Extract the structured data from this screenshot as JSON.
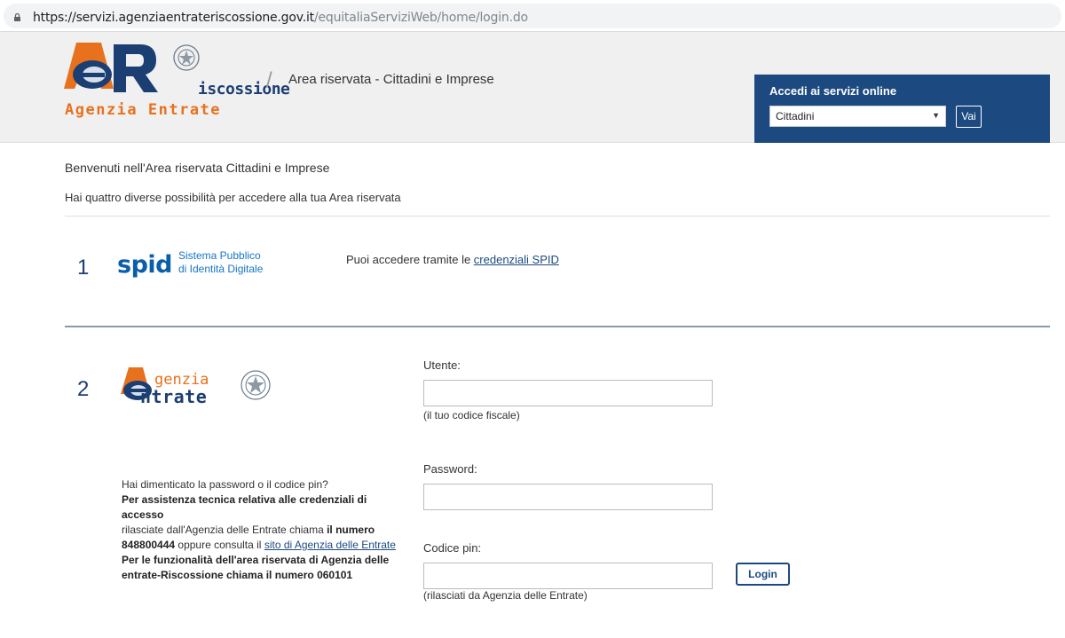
{
  "browser": {
    "url_host": "https://servizi.agenziaentrateriscossione.gov.it",
    "url_path": "/equitaliaServiziWeb/home/login.do"
  },
  "header": {
    "logo_text_riscossione": "iscossione",
    "logo_text_agenzia": "Agenzia Entrate",
    "area_title": "Area riservata - Cittadini e Imprese",
    "access_box": {
      "title": "Accedi ai servizi online",
      "selected_option": "Cittadini",
      "go_button": "Vai"
    }
  },
  "main": {
    "welcome": "Benvenuti nell'Area riservata Cittadini e Imprese",
    "subtitle": "Hai quattro diverse possibilità per accedere alla tua Area riservata",
    "option1": {
      "number": "1",
      "spid_word": "spid",
      "spid_sub_line1": "Sistema Pubblico",
      "spid_sub_line2": "di Identità Digitale",
      "text_prefix": "Puoi accedere tramite le ",
      "link_text": "credenziali SPID"
    },
    "option2": {
      "number": "2",
      "logo_agenzia": "genzia",
      "logo_entrate": "ntrate",
      "help": {
        "line1": "Hai dimenticato la password o il codice pin?",
        "line2_bold": "Per assistenza tecnica relativa alle credenziali di accesso",
        "line3_normal": "rilasciate dall'Agenzia delle Entrate chiama ",
        "line3_bold": "il numero",
        "line4_bold": "848800444",
        "line4_normal": " oppure consulta il ",
        "line4_link": "sito di Agenzia delle Entrate",
        "line5_bold": "Per le funzionalità dell'area riservata di Agenzia delle entrate-Riscossione chiama il numero 060101"
      },
      "form": {
        "user_label": "Utente:",
        "user_hint": "(il tuo codice fiscale)",
        "password_label": "Password:",
        "pin_label": "Codice pin:",
        "pin_hint": "(rilasciati da Agenzia delle Entrate)",
        "login_button": "Login"
      }
    }
  },
  "colors": {
    "brand_blue": "#1c4a80",
    "brand_orange": "#e8711e",
    "spid_blue": "#0b5ea8"
  }
}
